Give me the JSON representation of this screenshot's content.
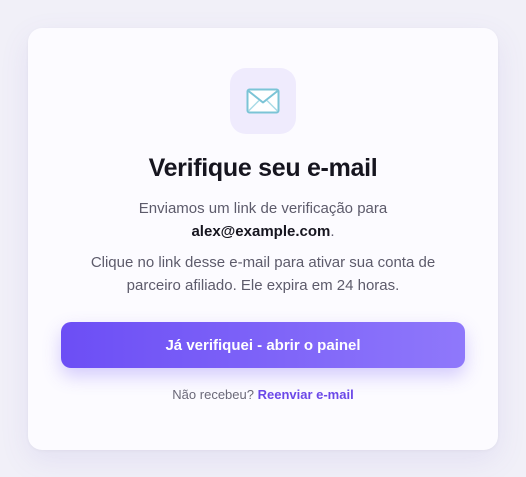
{
  "card": {
    "icon": "envelope-icon",
    "title": "Verifique seu e-mail",
    "sent_text": "Enviamos um link de verificação para",
    "email": "alex@example.com",
    "email_suffix": ".",
    "instructions": "Clique no link desse e-mail para ativar sua conta de parceiro afiliado. Ele expira em 24 horas.",
    "primary_button_label": "Já verifiquei - abrir o painel",
    "resend_prompt": "Não recebeu?",
    "resend_link_label": "Reenviar e-mail"
  },
  "colors": {
    "accent": "#6c4ef5",
    "accent_light": "#8f78fb",
    "link": "#6b48e8",
    "icon_badge_bg": "#efebfd",
    "page_bg": "#f1f0f8",
    "card_bg": "#fcfbff"
  }
}
